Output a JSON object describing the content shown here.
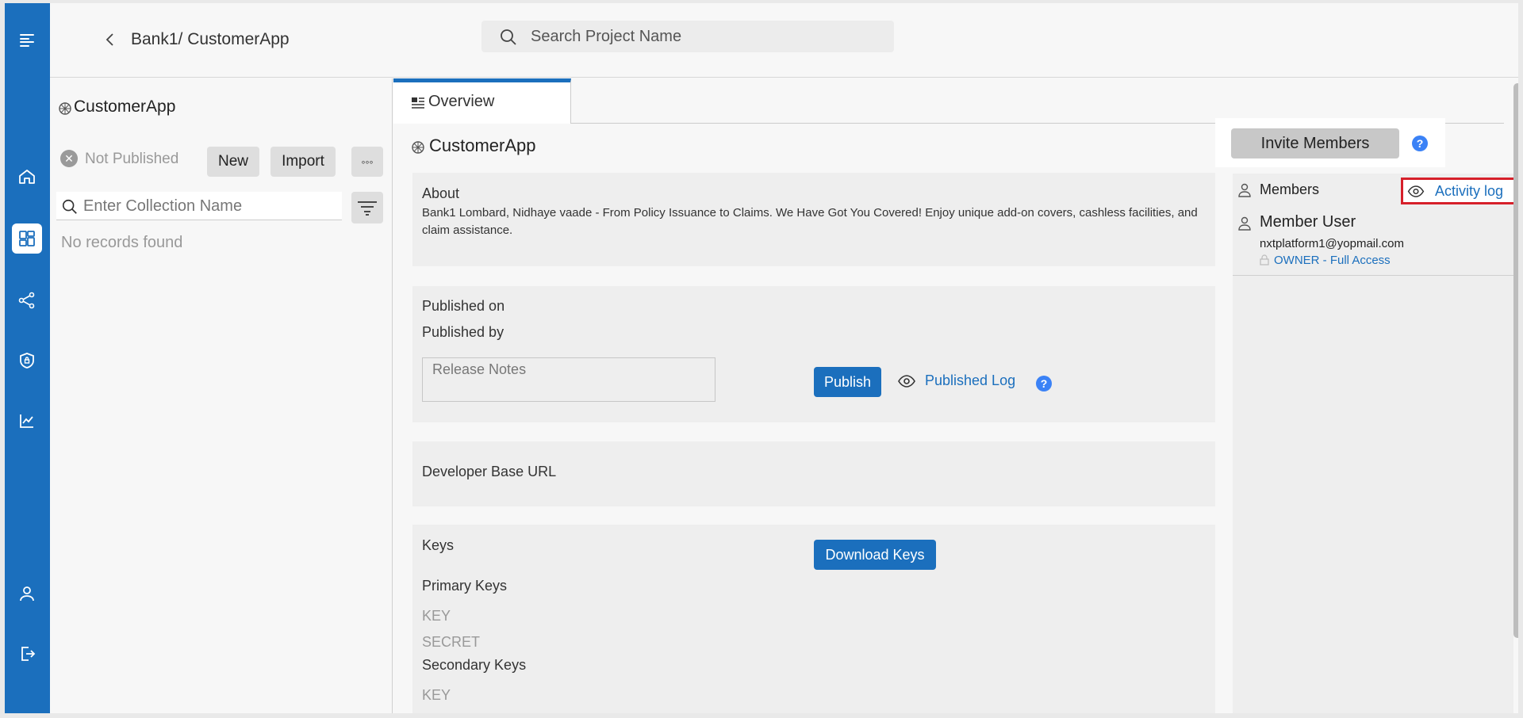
{
  "header": {
    "breadcrumb": "Bank1/ CustomerApp",
    "search_placeholder": "Search Project Name"
  },
  "rail": {
    "items": [
      "menu-icon",
      "home-icon",
      "dashboard-icon",
      "share-icon",
      "shield-icon",
      "chart-icon",
      "user-icon",
      "logout-icon"
    ],
    "active": "dashboard-icon"
  },
  "collections": {
    "title": "CustomerApp",
    "status": "Not Published",
    "new_label": "New",
    "import_label": "Import",
    "more_label": "◦◦◦",
    "search_placeholder": "Enter Collection Name",
    "empty_text": "No records found"
  },
  "main": {
    "tab_label": "Overview",
    "title": "CustomerApp",
    "about": {
      "label": "About",
      "text": "Bank1 Lombard, Nidhaye vaade - From Policy Issuance to Claims. We Have Got You Covered! Enjoy unique add-on covers, cashless facilities, and claim assistance."
    },
    "publish": {
      "published_on_label": "Published on",
      "published_by_label": "Published by",
      "release_notes_placeholder": "Release Notes",
      "publish_label": "Publish",
      "published_log_label": "Published Log",
      "help": "?"
    },
    "developer": {
      "label": "Developer Base URL"
    },
    "keys": {
      "label": "Keys",
      "download_label": "Download Keys",
      "primary_label": "Primary Keys",
      "primary_key": "KEY",
      "primary_secret": "SECRET",
      "secondary_label": "Secondary Keys",
      "secondary_key": "KEY"
    }
  },
  "members": {
    "invite_label": "Invite Members",
    "help": "?",
    "header_label": "Members",
    "activity_label": "Activity log",
    "user": {
      "name": "Member User",
      "email": "nxtplatform1@yopmail.com",
      "role": "OWNER - Full Access"
    }
  },
  "colors": {
    "brand": "#1b6fbd",
    "highlight": "#d6202a"
  }
}
